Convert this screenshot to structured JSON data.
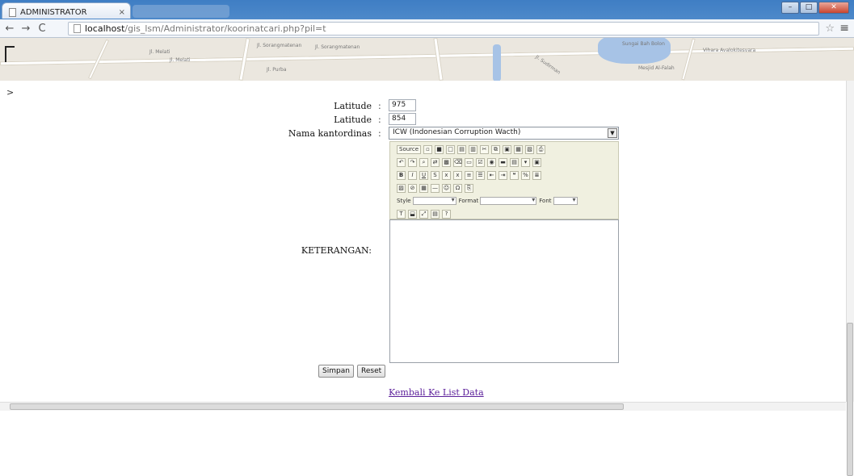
{
  "browser": {
    "tab_title": "ADMINISTRATOR",
    "tab_close": "×",
    "url_host": "localhost",
    "url_path": "/gis_lsm/Administrator/koorinatcari.php?pil=t"
  },
  "map": {
    "labels": [
      "Jl. Sorangmatenan",
      "Jl. Sorangmatenan",
      "Jl. Melati",
      "Jl. Melati",
      "Jl. Purba",
      "Sungai Bah Bolon",
      "Mesjid Al-Falah",
      "Vihara Avalokitesvara",
      "Jl. Sudirman"
    ]
  },
  "page": {
    "gt_text": ">",
    "latitude_label": "Latitude",
    "latitude_value": "975",
    "longitude_label": "Latitude",
    "longitude_value": "854",
    "kantor_label": "Nama kantordinas",
    "colon": ":",
    "kantor_selected": "ICW (Indonesian Corruption Wacth)",
    "keterangan_label": "KETERANGAN:",
    "save_label": "Simpan",
    "reset_label": "Reset",
    "back_link": "Kembali Ke List Data"
  },
  "editor": {
    "source_label": "Source",
    "style_label": "Style",
    "format_label": "Format",
    "font_label": "Font",
    "bold": "B",
    "italic": "I",
    "underline": "U"
  }
}
